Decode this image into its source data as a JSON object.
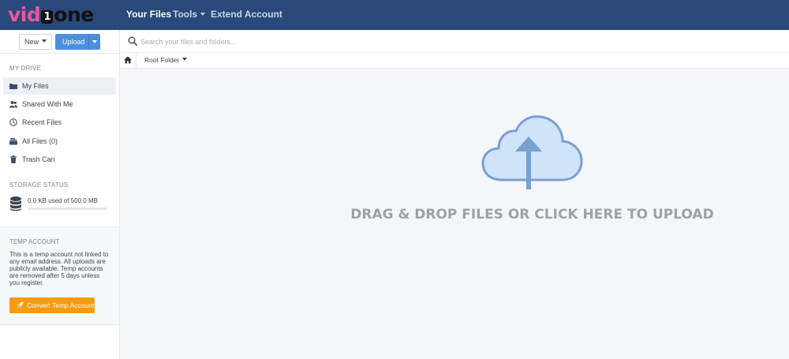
{
  "header": {
    "logo": {
      "part1": "vid",
      "part2": "1",
      "part3": "one"
    },
    "nav": [
      {
        "label": "Your Files",
        "active": true
      },
      {
        "label": "Tools",
        "dropdown": true
      },
      {
        "label": "Extend Account"
      }
    ]
  },
  "toolbar": {
    "new_label": "New",
    "upload_label": "Upload"
  },
  "search": {
    "placeholder": "Search your files and folders..."
  },
  "breadcrumb": {
    "root_label": "Root Folder"
  },
  "sidebar": {
    "section_title": "MY DRIVE",
    "items": [
      {
        "label": "My Files",
        "icon": "folder-icon",
        "selected": true
      },
      {
        "label": "Shared With Me",
        "icon": "users-icon"
      },
      {
        "label": "Recent Files",
        "icon": "clock-icon"
      },
      {
        "label": "All Files (0)",
        "icon": "files-icon"
      },
      {
        "label": "Trash Can",
        "icon": "trash-icon"
      }
    ],
    "storage": {
      "title": "STORAGE STATUS",
      "text": "0.0 KB used of 500.0 MB",
      "used_fraction": 0
    },
    "temp": {
      "title": "TEMP ACCOUNT",
      "text": "This is a temp account not linked to any email address. All uploads are publicly available. Temp accounts are removed after 5 days unless you register.",
      "button_label": "Convert Temp Account"
    }
  },
  "upload_area": {
    "label": "DRAG & DROP FILES OR CLICK HERE TO UPLOAD"
  },
  "colors": {
    "header_bg": "#28497a",
    "accent_blue": "#4a8fe0",
    "convert_orange": "#f39c12",
    "logo_pink": "#e6589b",
    "cloud_fill": "#cfe4f8",
    "cloud_stroke": "#7aa0d2"
  }
}
